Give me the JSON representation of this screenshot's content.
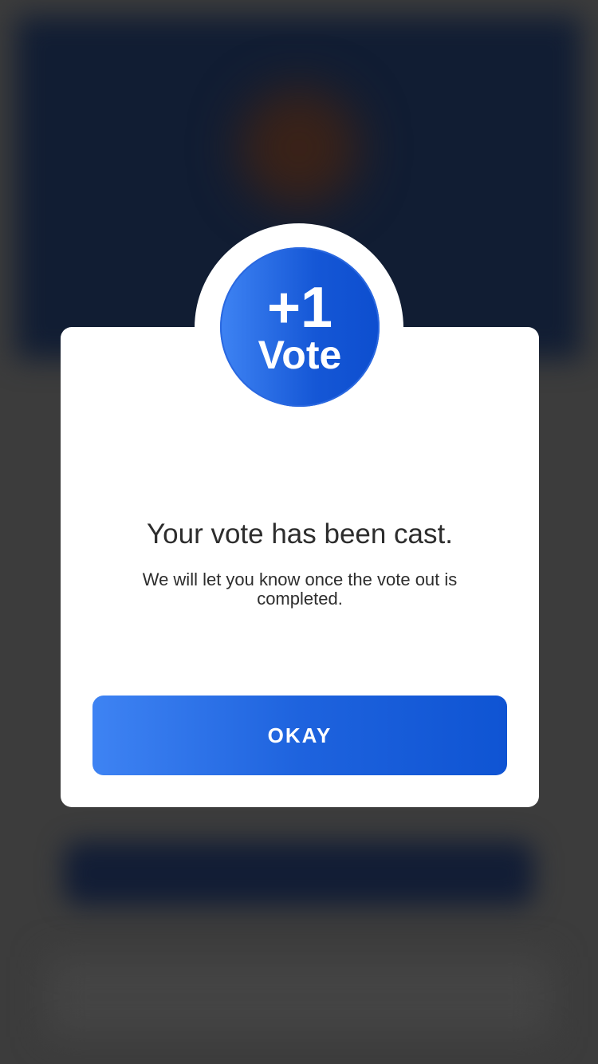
{
  "background": {
    "description": "blurred app screen behind modal"
  },
  "modal": {
    "badge_plus": "+1",
    "badge_label": "Vote",
    "title": "Your vote has been cast.",
    "subtitle": "We will let you know once the vote out is completed.",
    "okay_label": "OKAY"
  },
  "colors": {
    "accent": "#1557d6",
    "accent_light": "#3e83f3",
    "overlay": "#3c3c3c"
  }
}
